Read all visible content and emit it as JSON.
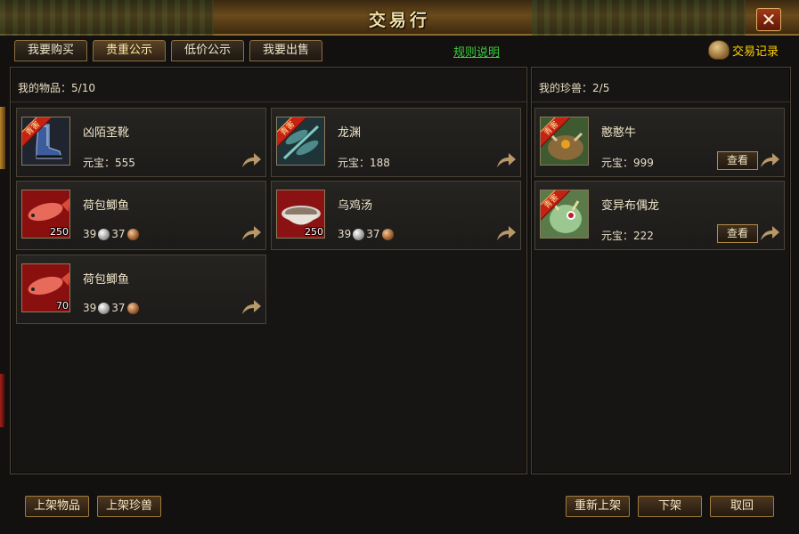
{
  "window": {
    "title": "交易行",
    "close_glyph": "✕"
  },
  "tabs": [
    {
      "label": "我要购买",
      "active": false
    },
    {
      "label": "贵重公示",
      "active": true
    },
    {
      "label": "低价公示",
      "active": false
    },
    {
      "label": "我要出售",
      "active": false
    }
  ],
  "rules_link": "规则说明",
  "records_label": "交易记录",
  "items_panel": {
    "header_label": "我的物品：",
    "count": "5/10",
    "items": [
      {
        "name": "凶陌圣靴",
        "price_label": "元宝：",
        "price": "555",
        "badge": "青害",
        "icon": "boots-icon"
      },
      {
        "name": "龙渊",
        "price_label": "元宝：",
        "price": "188",
        "badge": "青害",
        "icon": "dragonfly-icon"
      },
      {
        "name": "荷包鲫鱼",
        "silver": "39",
        "copper": "37",
        "quantity": "250",
        "icon": "fish-icon"
      },
      {
        "name": "乌鸡汤",
        "silver": "39",
        "copper": "37",
        "quantity": "250",
        "icon": "soup-bowl-icon"
      },
      {
        "name": "荷包鲫鱼",
        "silver": "39",
        "copper": "37",
        "quantity": "70",
        "icon": "fish-icon"
      }
    ]
  },
  "pets_panel": {
    "header_label": "我的珍兽：",
    "count": "2/5",
    "pets": [
      {
        "name": "憨憨牛",
        "price_label": "元宝：",
        "price": "999",
        "badge": "青害",
        "view_label": "查看",
        "icon": "ox-pet-icon"
      },
      {
        "name": "变异布偶龙",
        "price_label": "元宝：",
        "price": "222",
        "badge": "青害",
        "view_label": "查看",
        "icon": "dragon-pet-icon"
      }
    ]
  },
  "bottom_buttons": {
    "list_item": "上架物品",
    "list_pet": "上架珍兽",
    "relist": "重新上架",
    "delist": "下架",
    "cancel": "取回"
  }
}
